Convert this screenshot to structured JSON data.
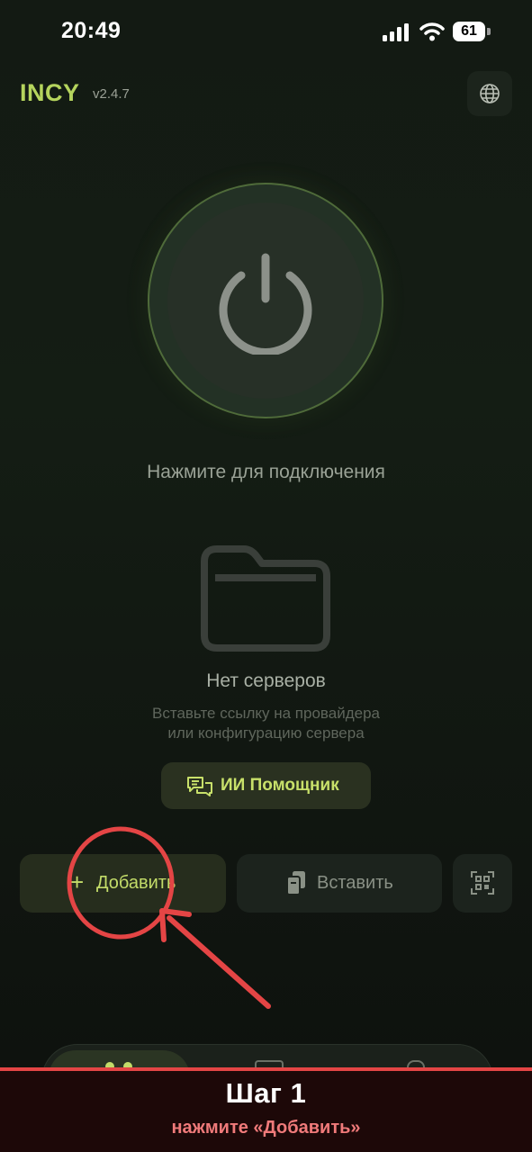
{
  "status_bar": {
    "time": "20:49",
    "battery": "61"
  },
  "header": {
    "app_name": "INCY",
    "version": "v2.4.7",
    "language_icon": "globe-icon"
  },
  "connection": {
    "hint": "Нажмите для подключения",
    "icon": "power-icon"
  },
  "servers": {
    "empty_title": "Нет серверов",
    "empty_hint_line1": "Вставьте ссылку на провайдера",
    "empty_hint_line2": "или конфигурацию сервера",
    "icon": "folder-icon"
  },
  "assistant": {
    "label": "ИИ Помощник",
    "icon": "chat-bubbles-icon"
  },
  "actions": {
    "add": {
      "label": "Добавить",
      "icon": "plus-icon"
    },
    "paste": {
      "label": "Вставить",
      "icon": "clipboard-icon"
    },
    "scan": {
      "icon": "qr-scan-icon"
    }
  },
  "annotation": {
    "step_title": "Шаг 1",
    "step_subtitle": "нажмите «Добавить»",
    "color": "#e44545"
  },
  "colors": {
    "accent": "#c3dc69",
    "background": "#131a13"
  }
}
